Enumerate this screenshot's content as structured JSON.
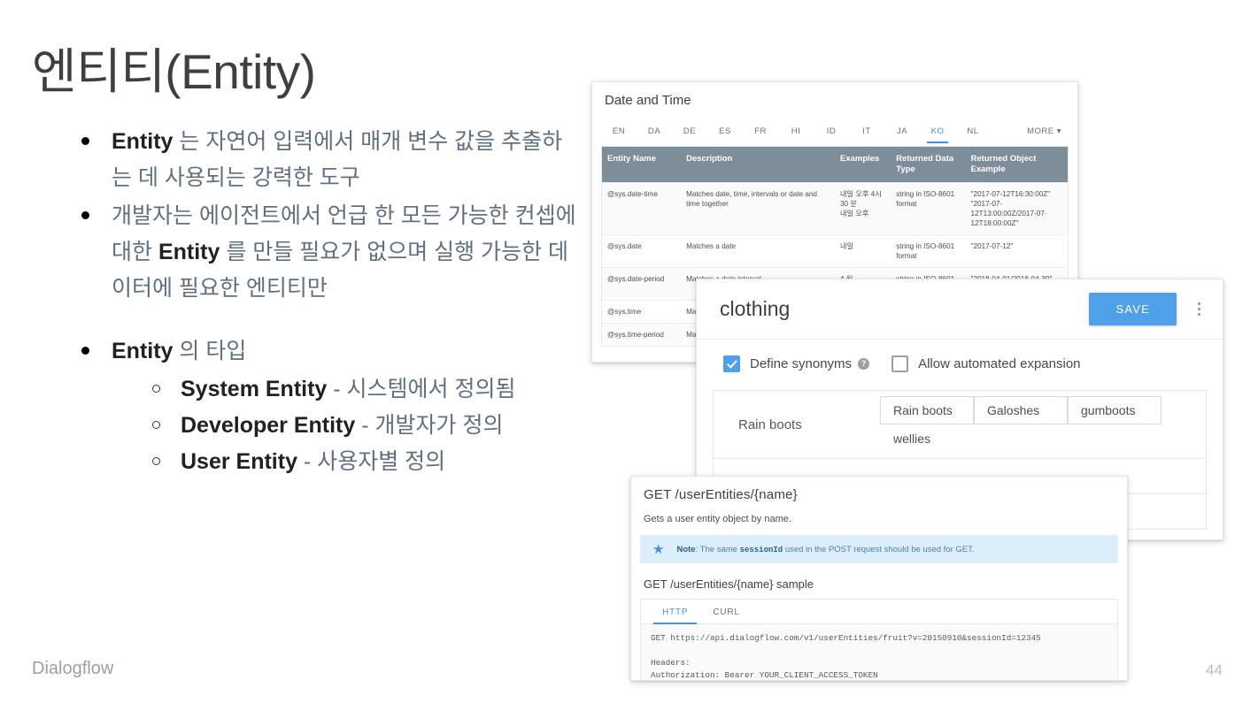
{
  "slide": {
    "title": "엔티티(Entity)",
    "bullets": [
      {
        "strong": "Entity",
        "rest": " 는 자연어 입력에서 매개 변수 값을 추출하는 데 사용되는 강력한 도구"
      },
      {
        "strong": "",
        "rest": "개발자는 에이전트에서 언급 한 모든 가능한 컨셉에 대한 Entity 를 만들 필요가 없으며 실행 가능한 데이터에 필요한 엔티티만"
      },
      {
        "strong": "Entity",
        "rest": " 의 타입"
      }
    ],
    "bullet2_line1_a": "개발자는 에이전트에서 언급 한 모든 가능한 컨셉에 대한 ",
    "bullet2_strong": "Entity",
    "bullet2_line1_b": " 를 만들 필요가 없으며 실행 가능한 데이터에 필요한 엔티티만",
    "subbullets": [
      {
        "strong": "System Entity",
        "rest": " - 시스템에서 정의됨"
      },
      {
        "strong": "Developer Entity",
        "rest": " - 개발자가 정의"
      },
      {
        "strong": "User Entity",
        "rest": " - 사용자별 정의"
      }
    ],
    "brand": "Dialogflow",
    "page_number": "44"
  },
  "datetime_panel": {
    "title": "Date and Time",
    "lang_tabs": [
      "EN",
      "DA",
      "DE",
      "ES",
      "FR",
      "HI",
      "ID",
      "IT",
      "JA",
      "KO",
      "NL"
    ],
    "active_lang": "KO",
    "more_label": "MORE",
    "columns": [
      "Entity Name",
      "Description",
      "Examples",
      "Returned Data Type",
      "Returned Object Example"
    ],
    "rows": [
      {
        "name": "@sys.date-time",
        "description": "Matches date, time, intervals or date and time together",
        "examples": "내일 오후 4시 30 분\n내일 오후",
        "type": "string in ISO-8601 format",
        "object": "\"2017-07-12T16:30:00Z\"\n\"2017-07-12T13:00:00Z/2017-07-12T18:00:00Z\""
      },
      {
        "name": "@sys.date",
        "description": "Matches a date",
        "examples": "내일",
        "type": "string in ISO-8601 format",
        "object": "\"2017-07-12\""
      },
      {
        "name": "@sys.date-period",
        "description": "Matches a date interval",
        "examples": "4 월",
        "type": "string in ISO-8601 format",
        "object": "\"2018-04-01/2018-04-30\""
      },
      {
        "name": "@sys.time",
        "description": "Matches a",
        "examples": "",
        "type": "",
        "object": ""
      },
      {
        "name": "@sys.time-period",
        "description": "Matches a",
        "examples": "",
        "type": "",
        "object": ""
      }
    ]
  },
  "clothing_panel": {
    "entity_name": "clothing",
    "save_label": "SAVE",
    "define_synonyms_label": "Define synonyms",
    "define_synonyms_checked": true,
    "allow_expansion_label": "Allow automated expansion",
    "allow_expansion_checked": false,
    "help_glyph": "?",
    "synonym_rows": [
      {
        "reference": "Rain boots",
        "synonyms": [
          "Rain boots",
          "Galoshes",
          "gumboots",
          "wellies"
        ]
      }
    ]
  },
  "api_panel": {
    "heading": "GET /userEntities/{name}",
    "description": "Gets a user entity object by name.",
    "note_label": "Note",
    "note_prefix": ": The same ",
    "note_code": "sessionId",
    "note_suffix": " used in the POST request should be used for GET.",
    "sample_heading": "GET /userEntities/{name} sample",
    "code_tabs": [
      "HTTP",
      "CURL"
    ],
    "active_code_tab": "HTTP",
    "code": "GET https://api.dialogflow.com/v1/userEntities/fruit?v=20150910&sessionId=12345\n\nHeaders:\nAuthorization: Bearer YOUR_CLIENT_ACCESS_TOKEN\nContent-Type: application/json"
  },
  "colors": {
    "accent_blue": "#4fa0e8",
    "table_header": "#7d8d99",
    "note_bg": "#ddeefb",
    "body_text": "#5f7080"
  }
}
